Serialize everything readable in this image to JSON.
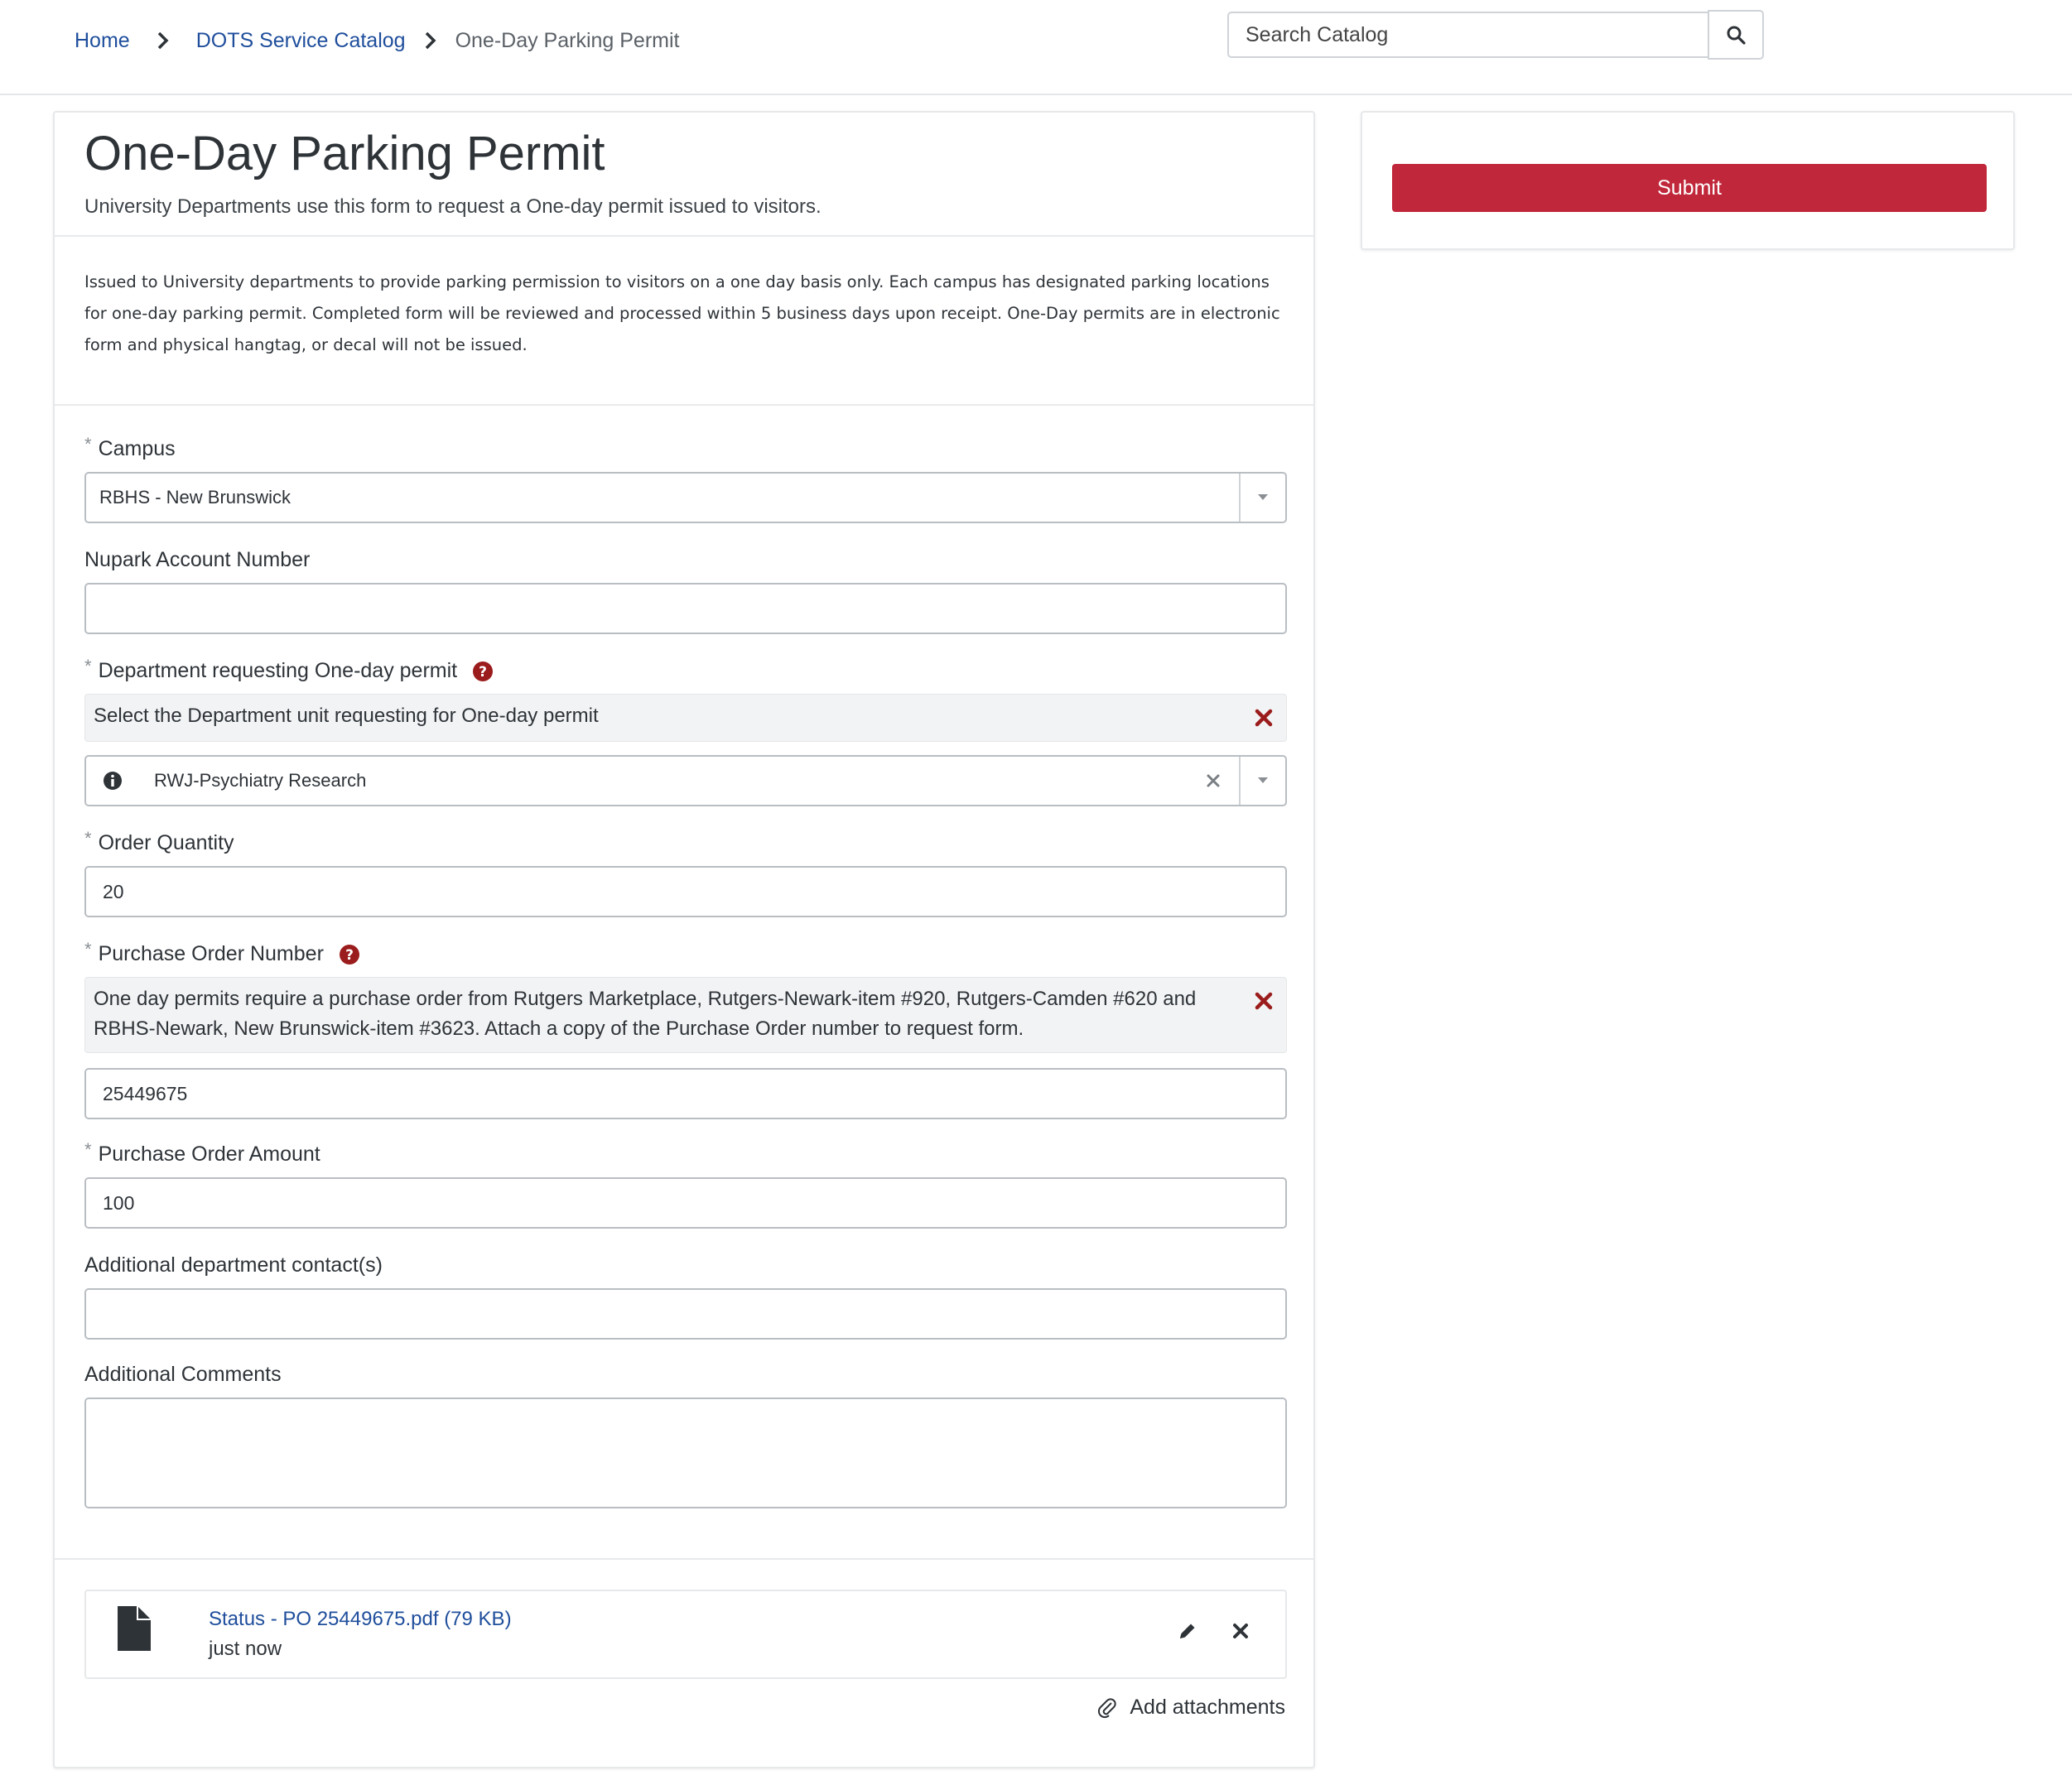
{
  "breadcrumb": {
    "home": "Home",
    "catalog": "DOTS Service Catalog",
    "current": "One-Day Parking Permit"
  },
  "search": {
    "placeholder": "Search Catalog"
  },
  "form": {
    "title": "One-Day Parking Permit",
    "subtitle": "University Departments use this form to request a One-day permit issued to visitors.",
    "intro": "Issued to University departments to provide parking permission to visitors on a one day basis only. Each campus has designated parking locations for one-day parking permit.  Completed form will be reviewed and processed within 5 business days upon receipt. One-Day permits are in electronic form and physical hangtag, or decal will not be issued.",
    "required_mark": "*",
    "campus": {
      "label": "Campus",
      "value": "RBHS - New Brunswick"
    },
    "nupark": {
      "label": "Nupark Account Number",
      "value": ""
    },
    "department": {
      "label": "Department requesting One-day permit",
      "help": "Select the Department unit requesting for One-day permit",
      "value": "RWJ-Psychiatry Research"
    },
    "order_quantity": {
      "label": "Order Quantity",
      "value": "20"
    },
    "po_number": {
      "label": "Purchase Order Number",
      "help": "One day permits require a purchase order from Rutgers Marketplace, Rutgers-Newark-item #920, Rutgers-Camden #620 and RBHS-Newark, New Brunswick-item #3623. Attach a copy of the Purchase Order number to request form.",
      "value": "25449675"
    },
    "po_amount": {
      "label": "Purchase Order Amount",
      "value": "100"
    },
    "contacts": {
      "label": "Additional department contact(s)",
      "value": ""
    },
    "comments": {
      "label": "Additional Comments",
      "value": ""
    }
  },
  "attachment": {
    "filename": "Status - PO 25449675.pdf (79 KB)",
    "time": "just now",
    "add_label": "Add attachments"
  },
  "actions": {
    "submit_label": "Submit"
  },
  "colors": {
    "accent": "#c0273a",
    "link": "#1f4e9c",
    "help": "#9b1c1c"
  }
}
